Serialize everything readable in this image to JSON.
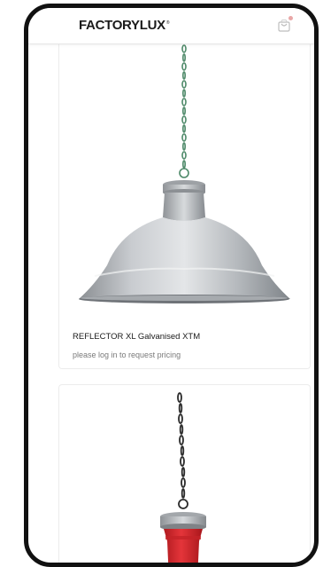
{
  "header": {
    "logo_text": "FACTORYLUX",
    "logo_mark": "®",
    "cart_icon": "cart-icon"
  },
  "products": [
    {
      "title": "REFLECTOR XL Galvanised XTM",
      "subtitle": "please log in to request pricing",
      "image_icon": "pendant-lamp-galvanised"
    },
    {
      "title": "",
      "subtitle": "",
      "image_icon": "pendant-lamp-red"
    }
  ],
  "colors": {
    "frame": "#111111",
    "lamp_red": "#d9262b",
    "galvanised": "#b9bcbf",
    "chain_green": "#4f8a6a"
  }
}
